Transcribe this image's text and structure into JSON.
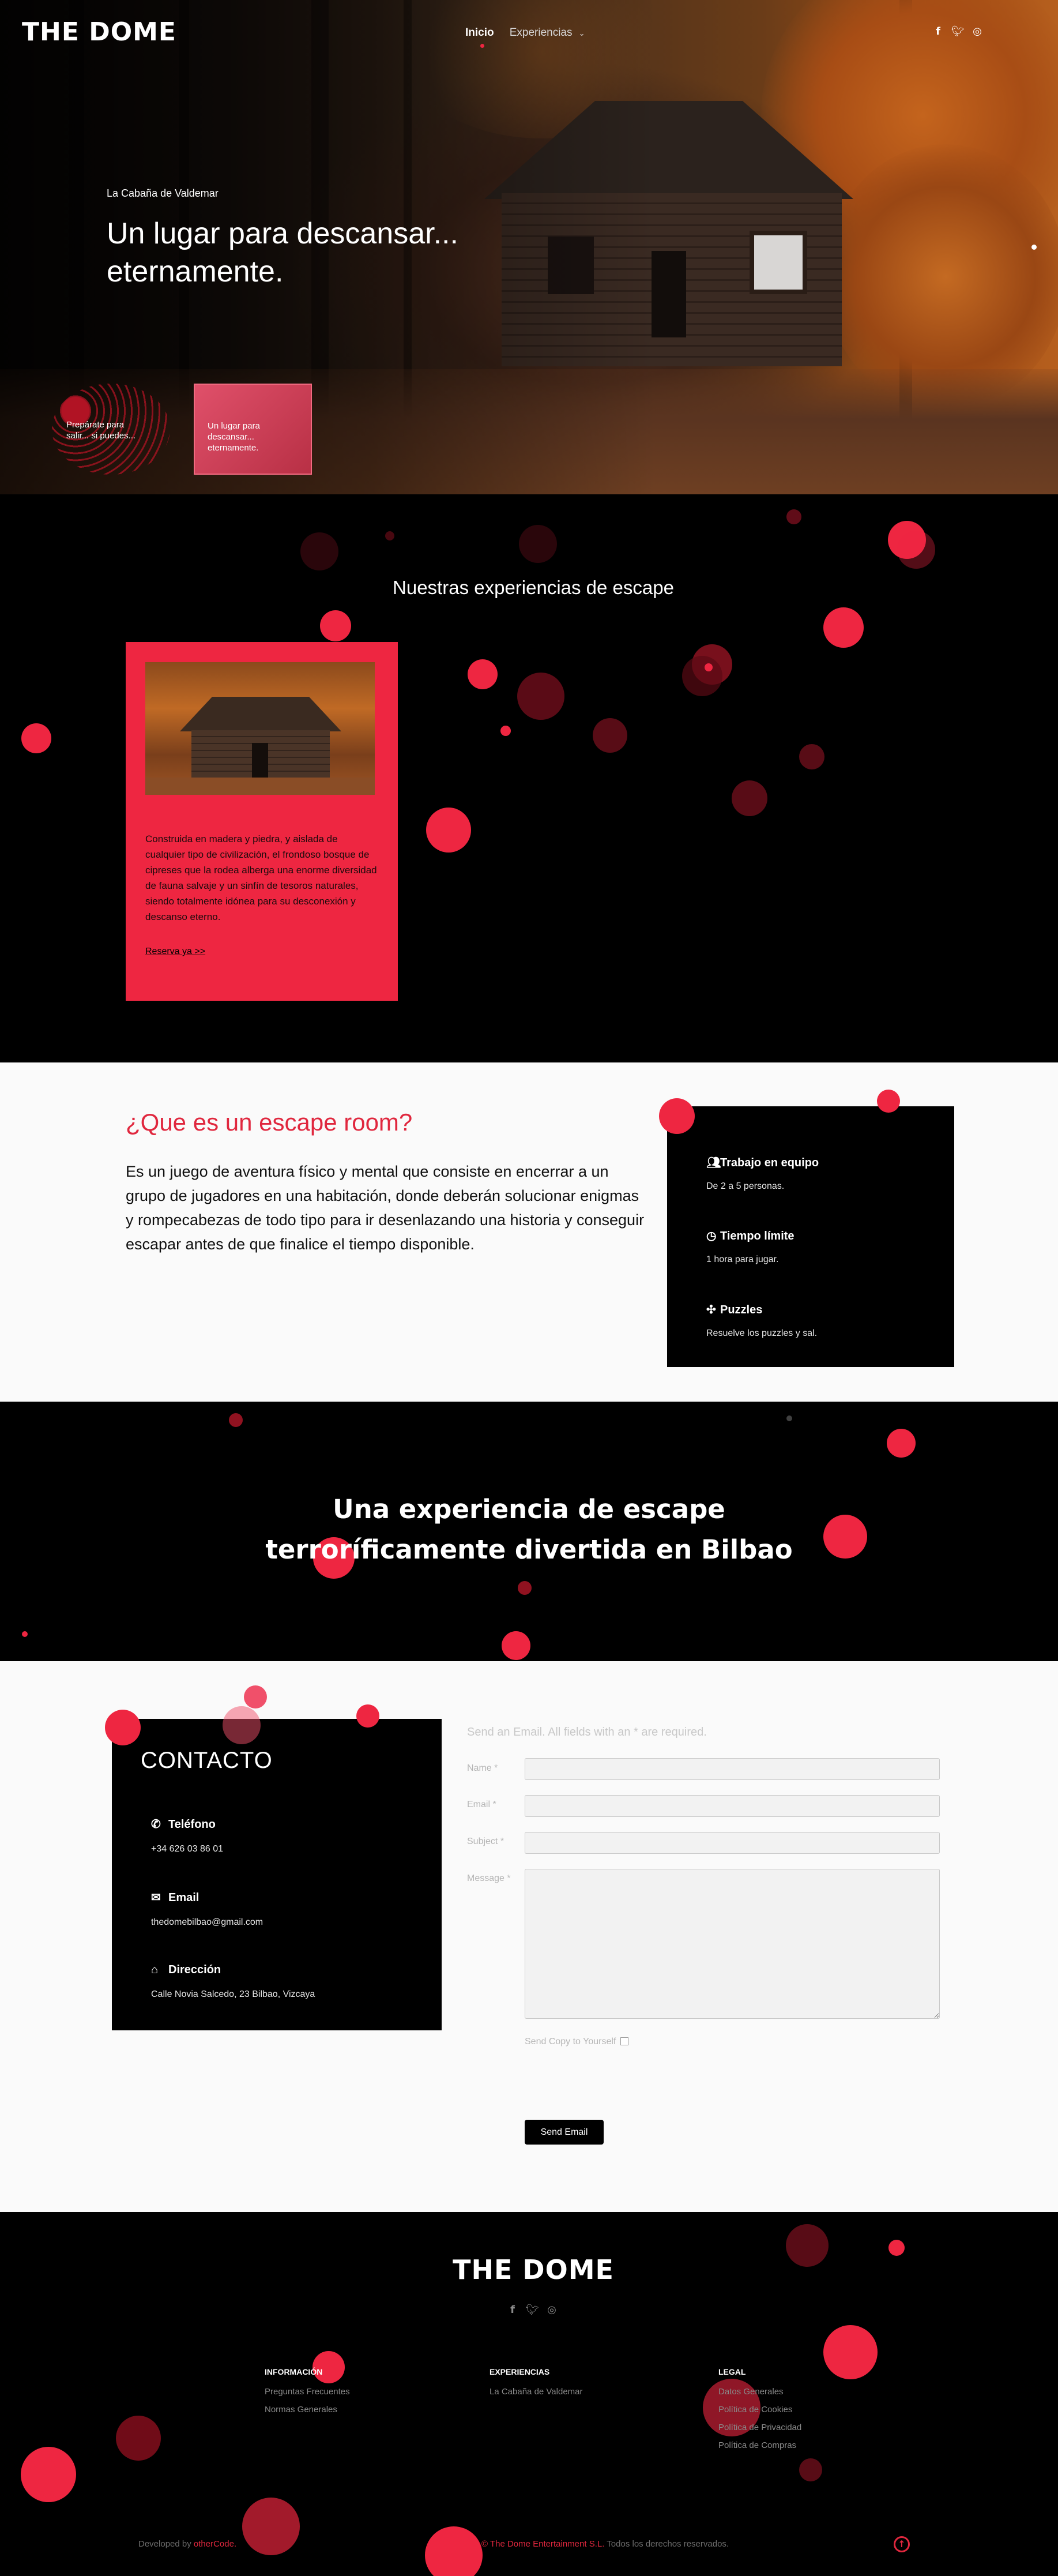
{
  "brand": {
    "logo": "THE DOME",
    "accent": "#ee2641"
  },
  "nav": {
    "items": [
      {
        "label": "Inicio",
        "active": true
      },
      {
        "label": "Experiencias",
        "has_dropdown": true
      }
    ],
    "socials": [
      "facebook-icon",
      "twitter-icon",
      "instagram-icon"
    ]
  },
  "hero": {
    "subtitle": "La Cabaña de Valdemar",
    "title": "Un lugar para descansar... eternamente.",
    "thumbs": [
      {
        "text": "Prepárate para salir... si puedes..."
      },
      {
        "text": "Un lugar para descansar... eternamente."
      }
    ]
  },
  "experiences": {
    "title": "Nuestras experiencias de escape",
    "card": {
      "text": "Construida en madera y piedra, y aislada de cualquier tipo de civilización, el frondoso bosque de cipreses que la rodea alberga una enorme diversidad de fauna salvaje y un sinfín de tesoros naturales, siendo totalmente idónea para su desconexión y descanso eterno.",
      "link": "Reserva ya >>"
    }
  },
  "escape_room": {
    "title": "¿Que es un escape room?",
    "text": "Es un juego de aventura físico y mental que consiste en encerrar a un grupo de jugadores en una habitación, donde deberán solucionar enigmas y rompecabezas de todo tipo para ir desenlazando una historia y conseguir escapar antes de que finalice el tiempo disponible.",
    "features": [
      {
        "icon": "users-icon",
        "title": "Trabajo en equipo",
        "desc": "De 2 a 5 personas."
      },
      {
        "icon": "clock-icon",
        "title": "Tiempo límite",
        "desc": "1 hora para jugar."
      },
      {
        "icon": "puzzle-icon",
        "title": "Puzzles",
        "desc": "Resuelve los puzzles y sal."
      }
    ]
  },
  "banner": {
    "line1": "Una experiencia de escape",
    "line2": "terroríficamente divertida en Bilbao"
  },
  "contact": {
    "title": "CONTACTO",
    "items": [
      {
        "icon": "phone-icon",
        "title": "Teléfono",
        "value": "+34 626 03 86 01"
      },
      {
        "icon": "envelope-icon",
        "title": "Email",
        "value": "thedomebilbao@gmail.com"
      },
      {
        "icon": "home-icon",
        "title": "Dirección",
        "value": "Calle Novia Salcedo, 23 Bilbao, Vizcaya"
      }
    ],
    "form": {
      "intro": "Send an Email. All fields with an * are required.",
      "name_label": "Name *",
      "email_label": "Email *",
      "subject_label": "Subject *",
      "message_label": "Message *",
      "name_value": "",
      "email_value": "",
      "subject_value": "",
      "message_value": "",
      "copy_label": "Send Copy to Yourself",
      "send_label": "Send Email"
    }
  },
  "footer": {
    "logo": "THE DOME",
    "socials": [
      "facebook-icon",
      "twitter-icon",
      "instagram-icon"
    ],
    "columns": [
      {
        "heading": "INFORMACIÓN",
        "items": [
          "Preguntas Frecuentes",
          "Normas Generales"
        ]
      },
      {
        "heading": "EXPERIENCIAS",
        "items": [
          "La Cabaña de Valdemar"
        ]
      },
      {
        "heading": "LEGAL",
        "items": [
          "Datos Generales",
          "Política de Cookies",
          "Política de Privacidad",
          "Política de Compras"
        ]
      }
    ],
    "developed_prefix": "Developed by",
    "developer": "otherCode.",
    "copyright_brand": "© The Dome Entertainment S.L.",
    "copyright_rest": "Todos los derechos reservados."
  }
}
